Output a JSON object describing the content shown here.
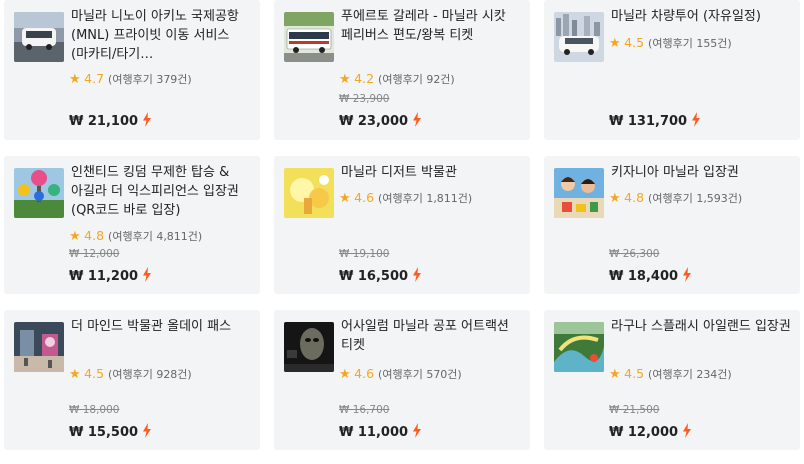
{
  "colors": {
    "accent_star": "#f5a623",
    "bolt": "#ff5a1f",
    "card_bg": "#f3f4f6"
  },
  "icons": {
    "rating": "star-icon",
    "instant": "lightning-bolt-icon"
  },
  "products": [
    {
      "title": "마닐라 니노이 아키노 국제공항 (MNL) 프라이빗 이동 서비스 (마카티/타기…",
      "rating": "4.7",
      "reviews": "(여행후기 379건)",
      "original_price": "",
      "price": "₩ 21,100"
    },
    {
      "title": "푸에르토 갈레라 - 마닐라 시캇 페리버스 편도/왕복 티켓",
      "rating": "4.2",
      "reviews": "(여행후기 92건)",
      "original_price": "₩ 23,900",
      "price": "₩ 23,000"
    },
    {
      "title": "마닐라 차량투어 (자유일정)",
      "rating": "4.5",
      "reviews": "(여행후기 155건)",
      "original_price": "",
      "price": "₩ 131,700"
    },
    {
      "title": "인챈티드 킹덤 무제한 탑승 & 아길라 더 익스피리언스 입장권 (QR코드 바로 입장)",
      "rating": "4.8",
      "reviews": "(여행후기 4,811건)",
      "original_price": "₩ 12,000",
      "price": "₩ 11,200"
    },
    {
      "title": "마닐라 디저트 박물관",
      "rating": "4.6",
      "reviews": "(여행후기 1,811건)",
      "original_price": "₩ 19,100",
      "price": "₩ 16,500"
    },
    {
      "title": "키자니아 마닐라 입장권",
      "rating": "4.8",
      "reviews": "(여행후기 1,593건)",
      "original_price": "₩ 26,300",
      "price": "₩ 18,400"
    },
    {
      "title": "더 마인드 박물관 올데이 패스",
      "rating": "4.5",
      "reviews": "(여행후기 928건)",
      "original_price": "₩ 18,000",
      "price": "₩ 15,500"
    },
    {
      "title": "어사일럼 마닐라 공포 어트랙션 티켓",
      "rating": "4.6",
      "reviews": "(여행후기 570건)",
      "original_price": "₩ 16,700",
      "price": "₩ 11,000"
    },
    {
      "title": "라구나 스플래시 아일랜드 입장권",
      "rating": "4.5",
      "reviews": "(여행후기 234건)",
      "original_price": "₩ 21,500",
      "price": "₩ 12,000"
    }
  ]
}
